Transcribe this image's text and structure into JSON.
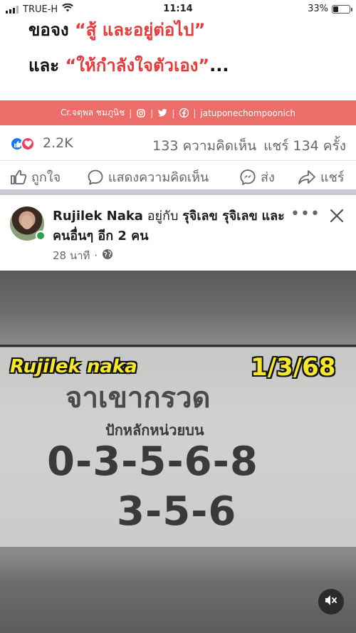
{
  "status_bar": {
    "carrier": "TRUE-H",
    "time": "11:14",
    "battery_percent": "33%",
    "battery_level": 0.33
  },
  "top_image": {
    "line1_black": "ขอจง",
    "line1_red": "“สู้ และอยู่ต่อไป”",
    "line2_black": "และ",
    "line2_red": "“ให้กำลังใจตัวเอง”",
    "line2_ellipsis": "...",
    "credit_text": "Cr.จตุพล ชมภูนิช",
    "credit_handle": "jatuponechompoonich",
    "colors": {
      "red": "#e83a3a",
      "credit_bar": "#ec6d6a"
    }
  },
  "reactions": {
    "count": "2.2K",
    "comments": "133 ความคิดเห็น",
    "shares": "แชร์ 134 ครั้ง",
    "icons": [
      "like-icon",
      "love-icon"
    ]
  },
  "actions": {
    "like": "ถูกใจ",
    "comment": "แสดงความคิดเห็น",
    "send": "ส่ง",
    "share": "แชร์"
  },
  "post": {
    "author": "Rujilek Naka",
    "with_text": "อยู่กับ",
    "tagged": "รุจิเลข รุจิเลข",
    "others": "และคนอื่นๆ อีก 2 คน",
    "time": "28 นาที",
    "privacy_icon": "globe-icon",
    "more_label": "•••"
  },
  "post_image": {
    "watermark": "Rujilek naka",
    "date": "1/3/68",
    "heading": "จาเขากรวด",
    "subheading": "ปักหลักหน่วยบน",
    "numbers_line1": "0-3-5-6-8",
    "numbers_line2": "3-5-6"
  }
}
